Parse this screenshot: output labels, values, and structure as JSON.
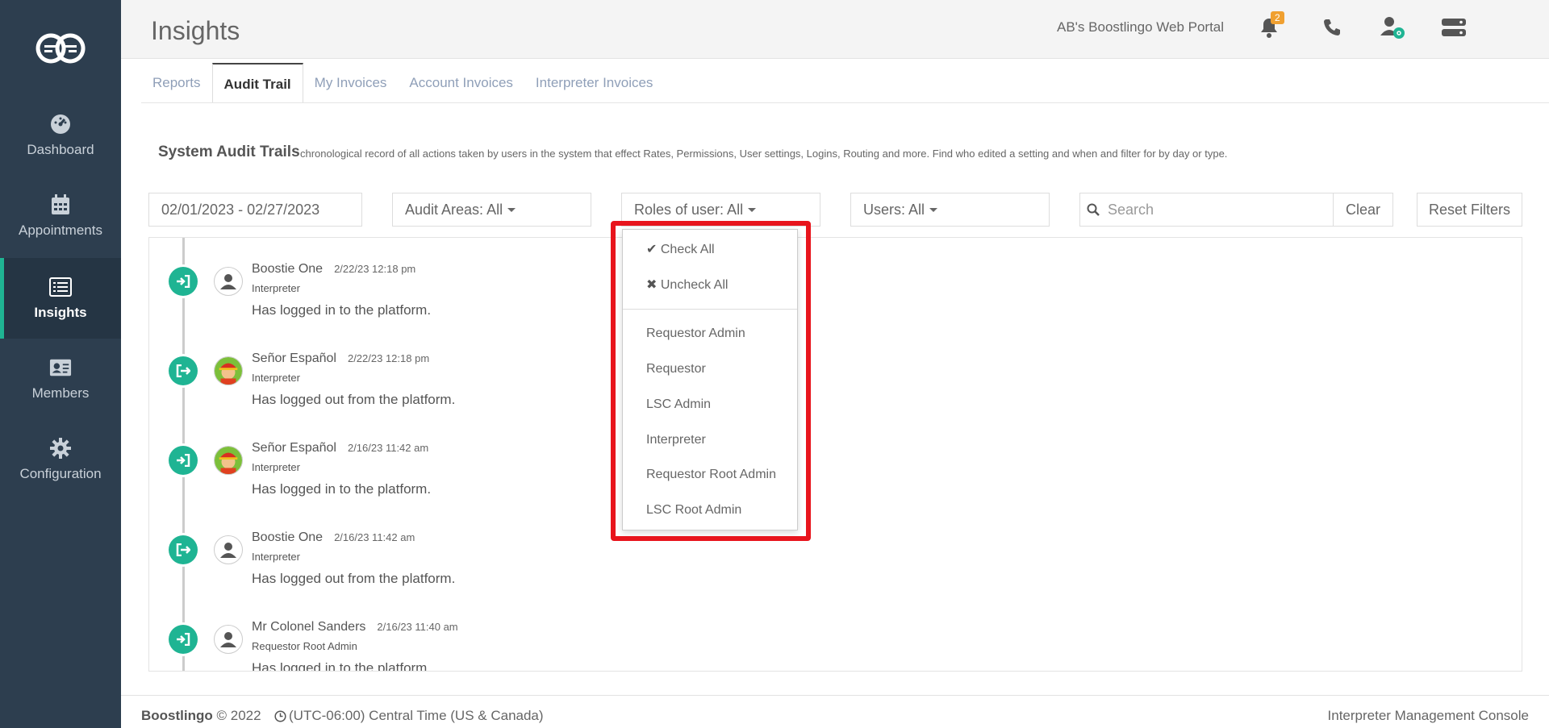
{
  "sidebar": {
    "items": [
      {
        "label": "Dashboard",
        "icon": "dashboard-icon"
      },
      {
        "label": "Appointments",
        "icon": "calendar-icon"
      },
      {
        "label": "Insights",
        "icon": "list-icon",
        "active": true
      },
      {
        "label": "Members",
        "icon": "id-card-icon"
      },
      {
        "label": "Configuration",
        "icon": "gear-icon"
      }
    ]
  },
  "header": {
    "title": "Insights",
    "portal_name": "AB's Boostlingo Web Portal",
    "notification_count": "2"
  },
  "tabs": [
    "Reports",
    "Audit Trail",
    "My Invoices",
    "Account Invoices",
    "Interpreter Invoices"
  ],
  "section": {
    "title": "System Audit Trails",
    "description": "chronological record of all actions taken by users in the system that effect Rates, Permissions, User settings, Logins, Routing and more. Find who edited a setting and when and filter for by day or type."
  },
  "filters": {
    "date_range": "02/01/2023 - 02/27/2023",
    "audit_areas": "Audit Areas: All",
    "roles": "Roles of user: All",
    "users": "Users: All",
    "search_placeholder": "Search",
    "clear_label": "Clear",
    "reset_label": "Reset Filters"
  },
  "feed": [
    {
      "name": "Boostie One",
      "date": "2/22/23 12:18 pm",
      "role": "Interpreter",
      "message": "Has logged in to the platform.",
      "action": "login"
    },
    {
      "name": "Señor Español",
      "date": "2/22/23 12:18 pm",
      "role": "Interpreter",
      "message": "Has logged out from the platform.",
      "action": "logout"
    },
    {
      "name": "Señor Español",
      "date": "2/16/23 11:42 am",
      "role": "Interpreter",
      "message": "Has logged in to the platform.",
      "action": "login"
    },
    {
      "name": "Boostie One",
      "date": "2/16/23 11:42 am",
      "role": "Interpreter",
      "message": "Has logged out from the platform.",
      "action": "logout"
    },
    {
      "name": "Mr Colonel Sanders",
      "date": "2/16/23 11:40 am",
      "role": "Requestor Root Admin",
      "message": "Has logged in to the platform.",
      "action": "login"
    }
  ],
  "dropdown": {
    "check_all": "Check All",
    "uncheck_all": "Uncheck All",
    "options": [
      "Requestor Admin",
      "Requestor",
      "LSC Admin",
      "Interpreter",
      "Requestor Root Admin",
      "LSC Root Admin"
    ]
  },
  "footer": {
    "brand": "Boostlingo",
    "copyright": "© 2022",
    "timezone": "(UTC-06:00) Central Time (US & Canada)",
    "right_text": "Interpreter Management Console"
  },
  "colors": {
    "sidebar_bg": "#2d3e4f",
    "accent": "#1fb493",
    "highlight": "#e8141c",
    "badge": "#f0a030"
  }
}
